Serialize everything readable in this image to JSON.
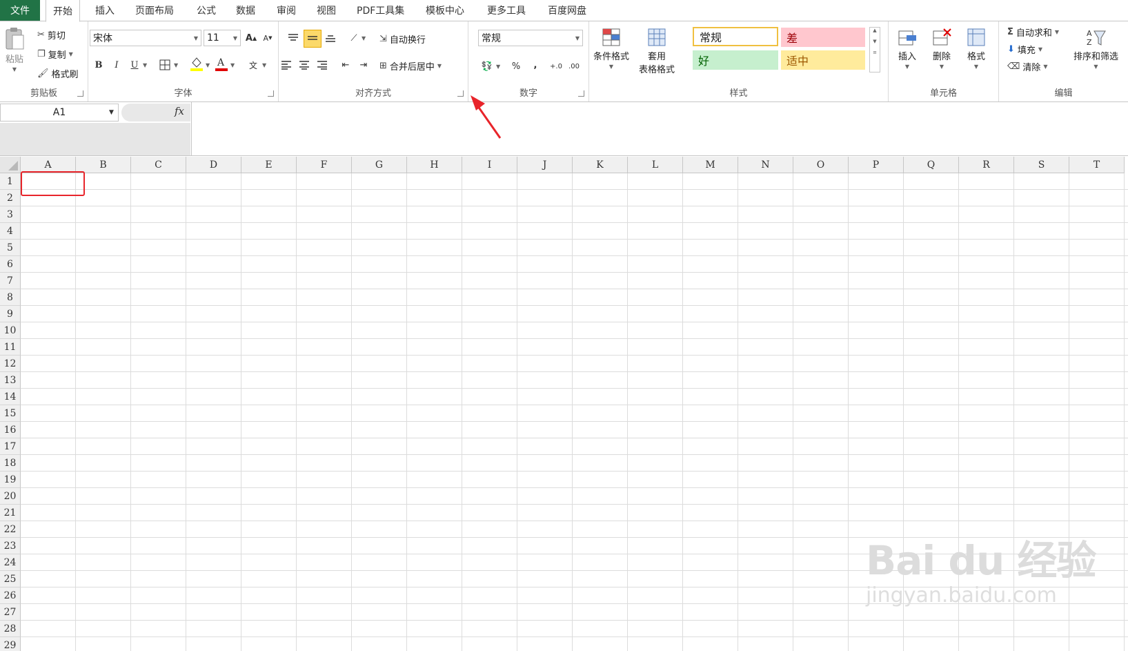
{
  "menu": {
    "file": "文件",
    "tabs": [
      "开始",
      "插入",
      "页面布局",
      "公式",
      "数据",
      "审阅",
      "视图",
      "PDF工具集",
      "模板中心",
      "更多工具",
      "百度网盘"
    ]
  },
  "clipboard": {
    "paste": "粘贴",
    "cut": "剪切",
    "copy": "复制",
    "format_painter": "格式刷",
    "label": "剪贴板"
  },
  "font": {
    "name": "宋体",
    "size": "11",
    "bold": "B",
    "italic": "I",
    "underline": "U",
    "label": "字体"
  },
  "alignment": {
    "wrap_text": "自动换行",
    "merge_center": "合并后居中",
    "label": "对齐方式"
  },
  "number": {
    "format": "常规",
    "percent": "%",
    "comma": ",",
    "label": "数字"
  },
  "styles": {
    "conditional": "条件格式",
    "table_line1": "套用",
    "table_line2": "表格格式",
    "normal": "常规",
    "bad": "差",
    "good": "好",
    "neutral": "适中",
    "label": "样式"
  },
  "cells": {
    "insert": "插入",
    "delete": "删除",
    "format": "格式",
    "label": "单元格"
  },
  "editing": {
    "autosum": "自动求和",
    "fill": "填充",
    "clear": "清除",
    "sort_filter": "排序和筛选",
    "label": "编辑"
  },
  "formula_bar": {
    "name_box": "A1",
    "fx": "fx"
  },
  "grid": {
    "columns": [
      "A",
      "B",
      "C",
      "D",
      "E",
      "F",
      "G",
      "H",
      "I",
      "J",
      "K",
      "L",
      "M",
      "N",
      "O",
      "P",
      "Q",
      "R",
      "S",
      "T"
    ],
    "rows": [
      "1",
      "2",
      "3",
      "4",
      "5",
      "6",
      "7",
      "8",
      "9",
      "10",
      "11",
      "12",
      "13",
      "14",
      "15",
      "16",
      "17",
      "18",
      "19",
      "20",
      "21",
      "22",
      "23",
      "24",
      "25",
      "26",
      "27",
      "28",
      "29"
    ]
  },
  "watermark": {
    "main": "Bai du 经验",
    "sub": "jingyan.baidu.com"
  },
  "colors": {
    "file_tab": "#217346",
    "highlight": "#e8242a",
    "bad_bg": "#ffc7ce",
    "good_bg": "#c6efce",
    "neutral_bg": "#ffeb9c"
  }
}
